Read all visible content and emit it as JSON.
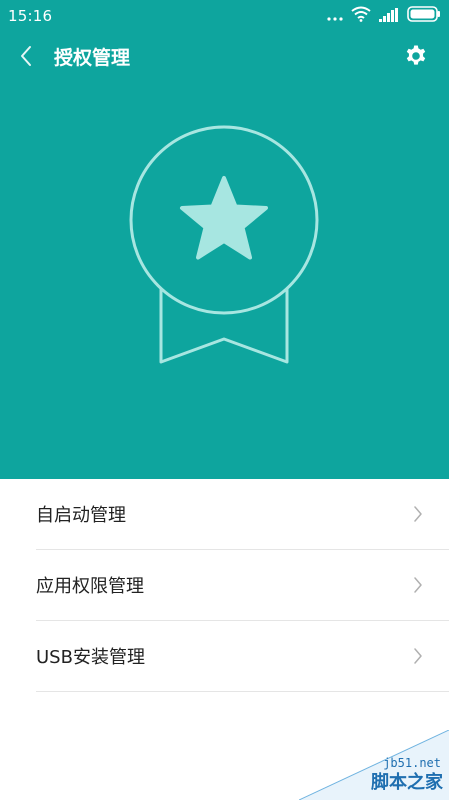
{
  "status_bar": {
    "time": "15:16",
    "icons": [
      "more-dots-icon",
      "wifi-icon",
      "signal-icon",
      "battery-icon"
    ]
  },
  "header": {
    "title": "授权管理",
    "back_icon": "back-chevron-icon",
    "settings_icon": "gear-icon"
  },
  "hero": {
    "background_color": "#0ea59e",
    "illustration": "award-badge-icon"
  },
  "menu": {
    "items": [
      {
        "label": "自启动管理"
      },
      {
        "label": "应用权限管理"
      },
      {
        "label": "USB安装管理"
      }
    ]
  },
  "watermark": {
    "domain": "jb51.net",
    "name": "脚本之家"
  },
  "colors": {
    "accent": "#0ea59e",
    "text": "#222222",
    "divider": "#e5e5e5"
  }
}
